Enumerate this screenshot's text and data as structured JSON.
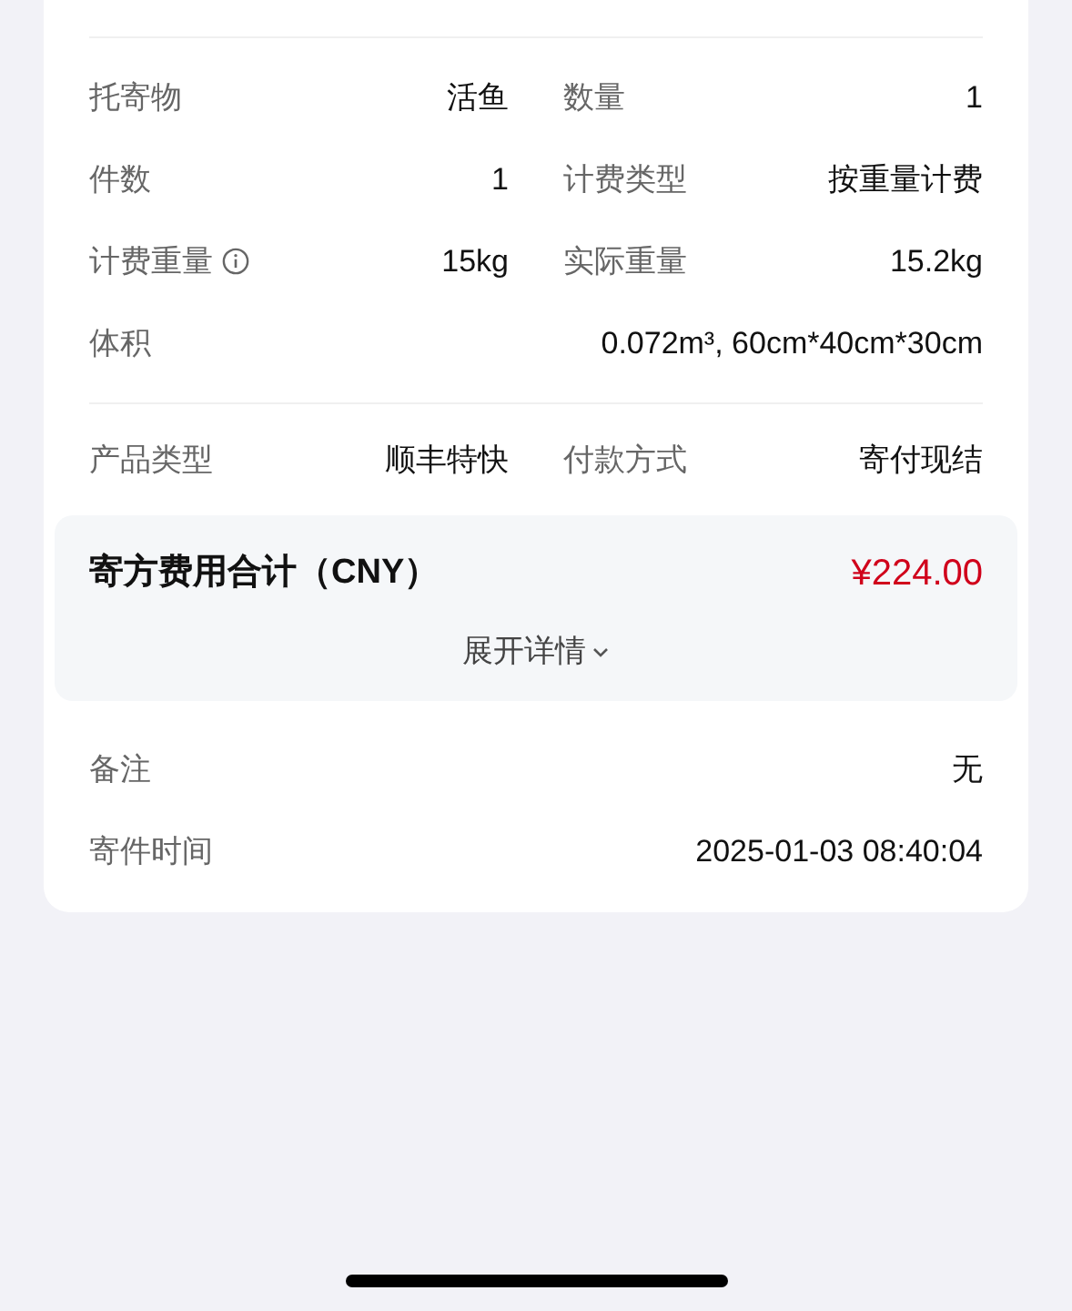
{
  "details": [
    {
      "kind": "pair",
      "label": "托寄物",
      "value": "活鱼"
    },
    {
      "kind": "pair",
      "label": "数量",
      "value": "1"
    },
    {
      "kind": "pair",
      "label": "件数",
      "value": "1"
    },
    {
      "kind": "pair",
      "label": "计费类型",
      "value": "按重量计费"
    },
    {
      "kind": "pair_info",
      "label": "计费重量",
      "value": "15kg"
    },
    {
      "kind": "pair",
      "label": "实际重量",
      "value": "15.2kg"
    },
    {
      "kind": "wide",
      "label": "体积",
      "value": "0.072m³, 60cm*40cm*30cm"
    }
  ],
  "service": [
    {
      "kind": "pair",
      "label": "产品类型",
      "value": "顺丰特快"
    },
    {
      "kind": "pair",
      "label": "付款方式",
      "value": "寄付现结"
    }
  ],
  "fee": {
    "label": "寄方费用合计（CNY）",
    "amount": "¥224.00",
    "toggle": "展开详情",
    "expanded": false
  },
  "extra": [
    {
      "kind": "wide",
      "label": "备注",
      "value": "无"
    },
    {
      "kind": "wide",
      "label": "寄件时间",
      "value": "2025-01-03 08:40:04"
    }
  ]
}
